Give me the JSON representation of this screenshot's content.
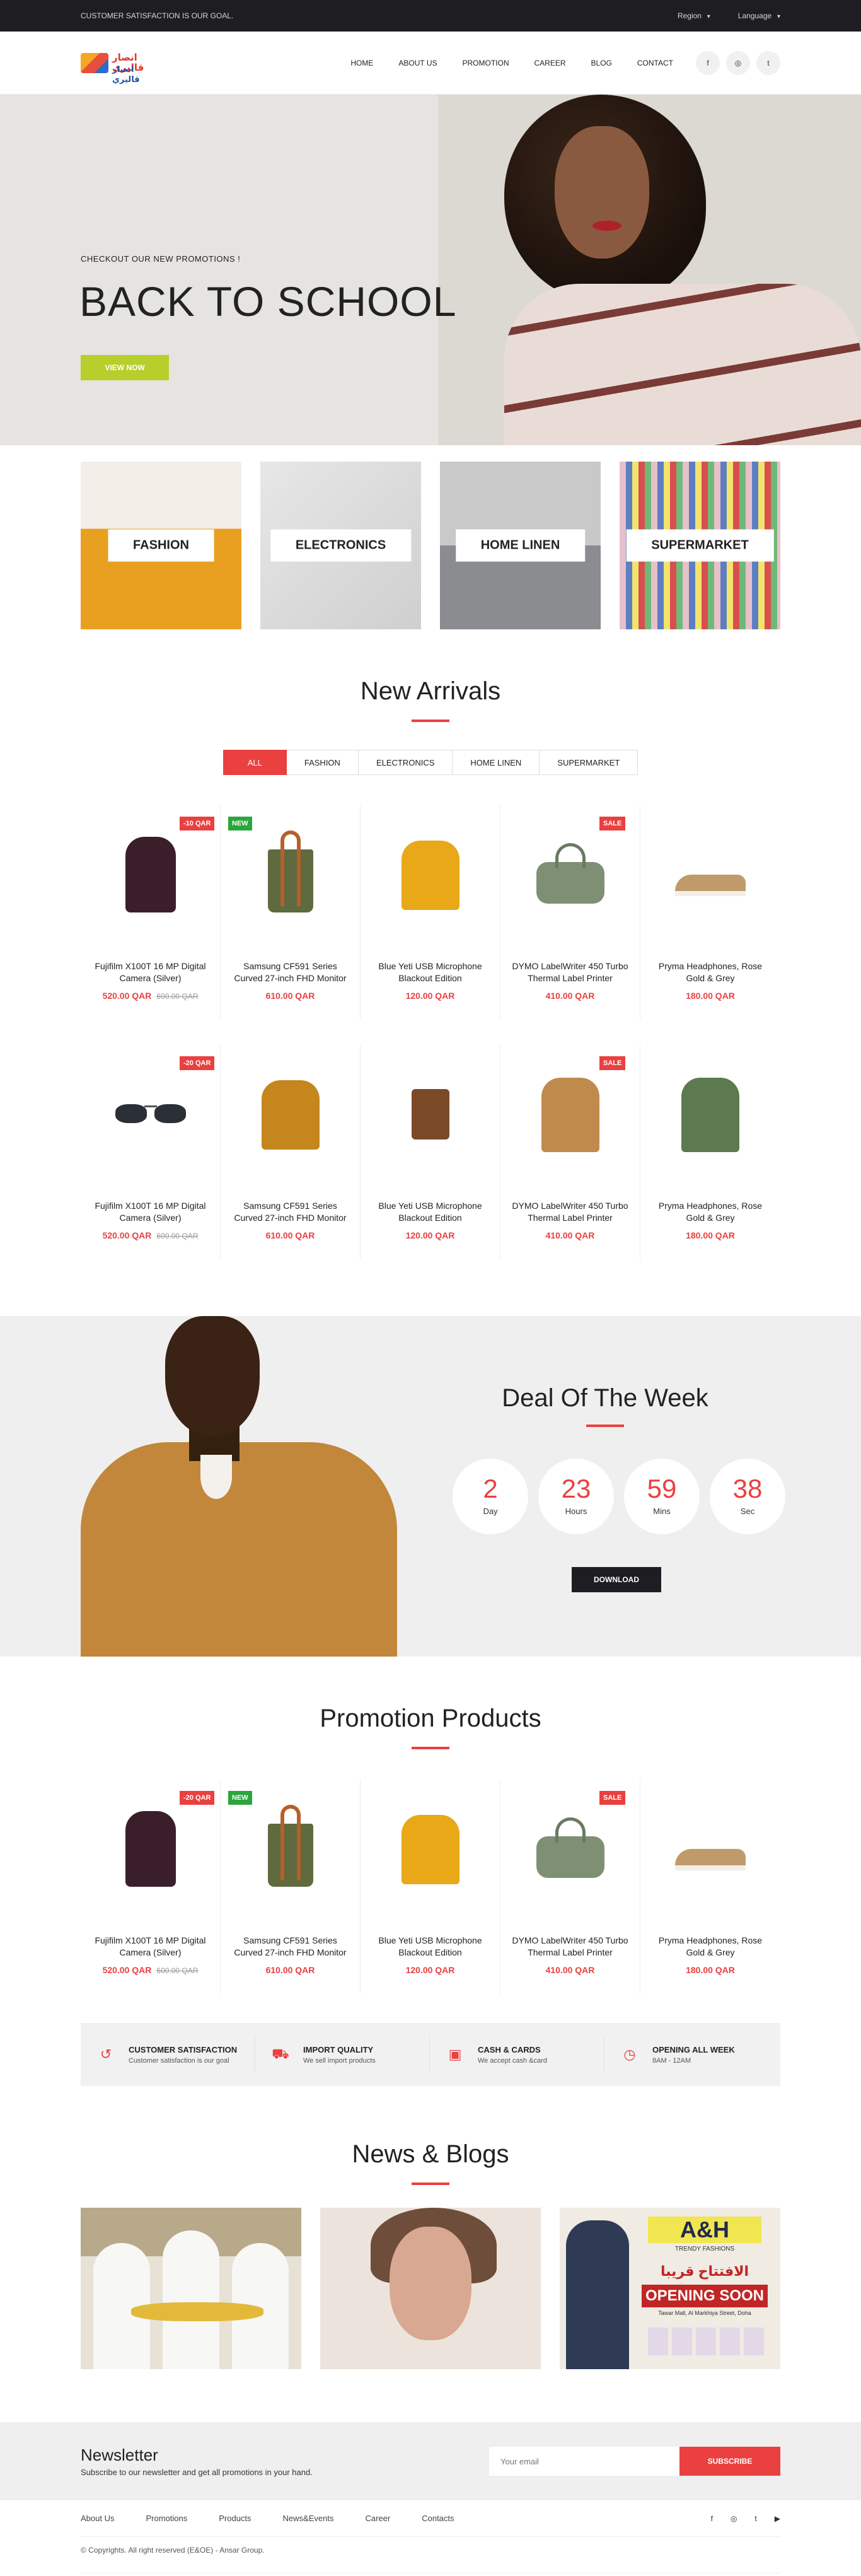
{
  "topbar": {
    "tagline": "CUSTOMER SATISFACTION IS OUR GOAL.",
    "region": "Region",
    "language": "Language"
  },
  "header": {
    "logo_text": "انصار قاليري",
    "logo_text2": "انصار قاليري",
    "nav": [
      "HOME",
      "ABOUT US",
      "PROMOTION",
      "CAREER",
      "BLOG",
      "CONTACT"
    ],
    "social": [
      "f",
      "◎",
      "t"
    ]
  },
  "hero": {
    "subtitle": "CHECKOUT OUR NEW PROMOTIONS !",
    "title": "BACK TO SCHOOL",
    "button": "VIEW NOW"
  },
  "categories": [
    "FASHION",
    "ELECTRONICS",
    "HOME LINEN",
    "SUPERMARKET"
  ],
  "arrivals": {
    "title": "New Arrivals",
    "tabs": [
      "ALL",
      "FASHION",
      "ELECTRONICS",
      "HOME LINEN",
      "SUPERMARKET"
    ],
    "row1": [
      {
        "name": "Fujifilm X100T 16 MP Digital Camera (Silver)",
        "price": "520.00 QAR",
        "old": "600.00 QAR",
        "badge": "-10 QAR"
      },
      {
        "name": "Samsung CF591 Series Curved 27-inch FHD Monitor",
        "price": "610.00 QAR",
        "old": "",
        "badge": "NEW"
      },
      {
        "name": "Blue Yeti USB Microphone Blackout Edition",
        "price": "120.00 QAR",
        "old": "",
        "badge": ""
      },
      {
        "name": "DYMO LabelWriter 450 Turbo Thermal Label Printer",
        "price": "410.00 QAR",
        "old": "",
        "badge": "SALE"
      },
      {
        "name": "Pryma Headphones, Rose Gold & Grey",
        "price": "180.00 QAR",
        "old": "",
        "badge": ""
      }
    ],
    "row2": [
      {
        "name": "Fujifilm X100T 16 MP Digital Camera (Silver)",
        "price": "520.00 QAR",
        "old": "600.00 QAR",
        "badge": "-20 QAR"
      },
      {
        "name": "Samsung CF591 Series Curved 27-inch FHD Monitor",
        "price": "610.00 QAR",
        "old": "",
        "badge": ""
      },
      {
        "name": "Blue Yeti USB Microphone Blackout Edition",
        "price": "120.00 QAR",
        "old": "",
        "badge": ""
      },
      {
        "name": "DYMO LabelWriter 450 Turbo Thermal Label Printer",
        "price": "410.00 QAR",
        "old": "",
        "badge": "SALE"
      },
      {
        "name": "Pryma Headphones, Rose Gold & Grey",
        "price": "180.00 QAR",
        "old": "",
        "badge": ""
      }
    ]
  },
  "deal": {
    "title": "Deal Of The Week",
    "timer": [
      {
        "value": "2",
        "label": "Day"
      },
      {
        "value": "23",
        "label": "Hours"
      },
      {
        "value": "59",
        "label": "Mins"
      },
      {
        "value": "38",
        "label": "Sec"
      }
    ],
    "button": "DOWNLOAD"
  },
  "promo": {
    "title": "Promotion Products",
    "items": [
      {
        "name": "Fujifilm X100T 16 MP Digital Camera (Silver)",
        "price": "520.00 QAR",
        "old": "600.00 QAR",
        "badge": "-20 QAR"
      },
      {
        "name": "Samsung CF591 Series Curved 27-inch FHD Monitor",
        "price": "610.00 QAR",
        "old": "",
        "badge": "NEW"
      },
      {
        "name": "Blue Yeti USB Microphone Blackout Edition",
        "price": "120.00 QAR",
        "old": "",
        "badge": ""
      },
      {
        "name": "DYMO LabelWriter 450 Turbo Thermal Label Printer",
        "price": "410.00 QAR",
        "old": "",
        "badge": "SALE"
      },
      {
        "name": "Pryma Headphones, Rose Gold & Grey",
        "price": "180.00 QAR",
        "old": "",
        "badge": ""
      }
    ]
  },
  "services": [
    {
      "icon": "refresh-icon",
      "title": "CUSTOMER SATISFACTION",
      "desc": "Customer satisfaction is our goal"
    },
    {
      "icon": "truck-icon",
      "title": "IMPORT QUALITY",
      "desc": "We sell import products"
    },
    {
      "icon": "cash-icon",
      "title": "CASH & CARDS",
      "desc": "We accept cash &card"
    },
    {
      "icon": "clock-icon",
      "title": "OPENING ALL WEEK",
      "desc": "8AM - 12AM"
    }
  ],
  "news": {
    "title": "News & Blogs",
    "blog3": {
      "brand": "A&H",
      "sub": "TRENDY FASHIONS",
      "arabic": "الافتتاح قريبا",
      "opening": "OPENING SOON",
      "address": "Tawar Mall, Al Markhiya Street, Doha"
    }
  },
  "newsletter": {
    "title": "Newsletter",
    "desc": "Subscribe to our newsletter and get all promotions in your hand.",
    "placeholder": "Your email",
    "button": "SUBSCRIBE"
  },
  "footer": {
    "links": [
      "About Us",
      "Promotions",
      "Products",
      "News&Events",
      "Career",
      "Contacts"
    ],
    "social": [
      "f",
      "◎",
      "t",
      "▶"
    ],
    "copyright": "© Copyrights. All right reserved (E&OE) - Ansar Group."
  },
  "colors": {
    "accent": "#ea4040",
    "lime": "#b6cf2b",
    "dark": "#1d1d22"
  }
}
